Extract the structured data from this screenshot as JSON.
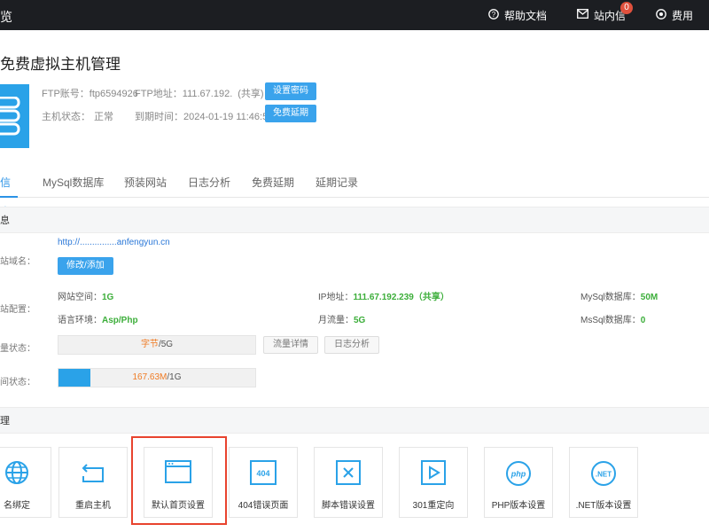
{
  "topbar": {
    "brand": "览",
    "help": "帮助文档",
    "messages": "站内信",
    "messages_count": "0",
    "billing": "费用"
  },
  "page_title": "免费虚拟主机管理",
  "meta": {
    "ftp_account_label": "FTP账号：",
    "ftp_account": "ftp6594926",
    "ftp_addr_label": "FTP地址：",
    "ftp_addr": "111.67.192.",
    "ftp_shared": "(共享)",
    "status_label": "主机状态：",
    "status": "正常",
    "expire_label": "到期时间：",
    "expire": "2024-01-19 11:46:57",
    "set_password": "设置密码",
    "free_extend": "免费延期"
  },
  "tabs": [
    "信息",
    "MySql数据库",
    "预装网站",
    "日志分析",
    "免费延期",
    "延期记录"
  ],
  "section1": "息",
  "domain": {
    "label": "站域名：",
    "value": "http://...............anfengyun.cn",
    "edit": "修改/添加"
  },
  "config": {
    "label": "站配置：",
    "space_label": "网站空间：",
    "space": "1G",
    "ip_label": "IP地址：",
    "ip": "111.67.192.239（共享）",
    "mysql_label": "MySql数据库：",
    "mysql": "50M",
    "lang_label": "语言环境：",
    "lang": "Asp/Php",
    "traffic_label": "月流量：",
    "traffic": "5G",
    "mssql_label": "MsSql数据库：",
    "mssql": "0"
  },
  "traffic": {
    "label": "量状态：",
    "used": "字节",
    "total": "/5G",
    "used_fraction": 0,
    "detail": "流量详情",
    "log": "日志分析"
  },
  "space": {
    "label": "间状态：",
    "used": "167.63M",
    "total": "/1G",
    "used_fraction": 0.164
  },
  "section2": "理",
  "tools": [
    {
      "label": "名绑定",
      "icon": "globe-icon"
    },
    {
      "label": "重启主机",
      "icon": "restart-icon"
    },
    {
      "label": "默认首页设置",
      "icon": "browser-window-icon"
    },
    {
      "label": "404错误页面",
      "icon": "404-icon"
    },
    {
      "label": "脚本错误设置",
      "icon": "close-box-icon"
    },
    {
      "label": "301重定向",
      "icon": "redirect-icon"
    },
    {
      "label": "PHP版本设置",
      "icon": "php-icon"
    },
    {
      "label": ".NET版本设置",
      "icon": "dotnet-icon"
    }
  ],
  "colors": {
    "accent": "#2aa2e8",
    "highlight": "#e8432e",
    "value_green": "#3cae3a",
    "orange": "#f07b24"
  }
}
